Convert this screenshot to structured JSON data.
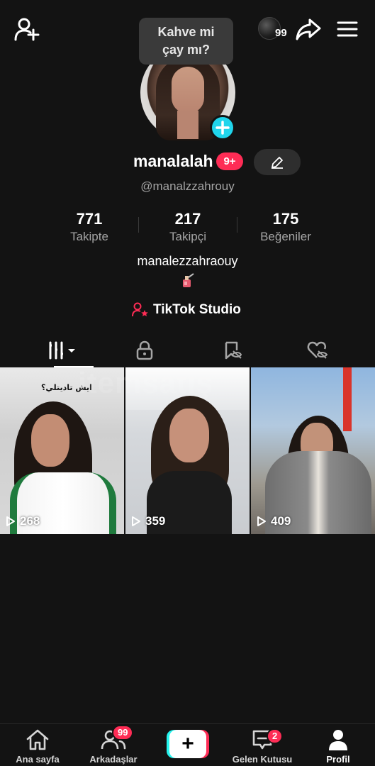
{
  "tooltip": {
    "line1": "Kahve mi",
    "line2": "çay mı?"
  },
  "coins": {
    "count": "99"
  },
  "profile": {
    "username": "manalalah",
    "notification_badge": "9+",
    "handle": "@manalzzahrouy",
    "bio": "manalezzahraouy",
    "studio_label": "TikTok Studio"
  },
  "stats": [
    {
      "value": "771",
      "label": "Takipte"
    },
    {
      "value": "217",
      "label": "Takipçi"
    },
    {
      "value": "175",
      "label": "Beğeniler"
    }
  ],
  "videos": [
    {
      "views": "268",
      "caption": "ايش تاديتلي؟"
    },
    {
      "views": "359"
    },
    {
      "views": "409"
    }
  ],
  "watermark": "itemsatış",
  "bottom_nav": {
    "home": "Ana sayfa",
    "friends": "Arkadaşlar",
    "friends_badge": "99",
    "create": "+",
    "inbox": "Gelen Kutusu",
    "inbox_badge": "2",
    "profile": "Profil"
  },
  "colors": {
    "accent_pink": "#fe2c55",
    "accent_cyan": "#20d5ec",
    "background": "#131313"
  }
}
